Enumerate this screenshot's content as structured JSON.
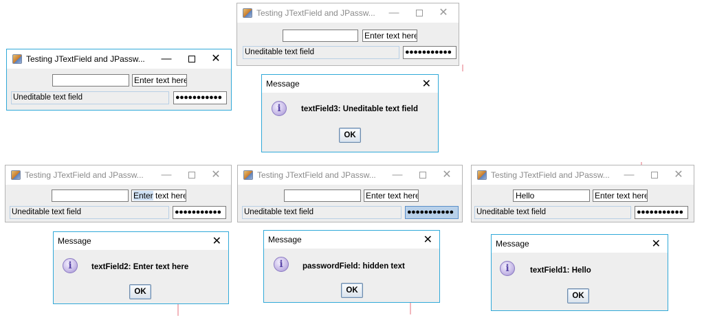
{
  "window_title": "Testing JTextField and JPassw...",
  "fields": {
    "unedit_label": "Uneditable text field",
    "enter_text": "Enter text here",
    "password_mask": "●●●●●●●●●●●"
  },
  "windows": [
    {
      "id": "top-center",
      "textField1": "",
      "state": "inactive"
    },
    {
      "id": "top-left",
      "textField1": "",
      "state": "active"
    },
    {
      "id": "bottom-left",
      "textField1": "",
      "state": "inactive"
    },
    {
      "id": "bottom-center",
      "textField1": "",
      "state": "inactive"
    },
    {
      "id": "bottom-right",
      "textField1": "Hello",
      "state": "inactive"
    }
  ],
  "dialogs": [
    {
      "title": "Message",
      "message": "textField3: Uneditable text field",
      "ok": "OK"
    },
    {
      "title": "Message",
      "message": "textField2: Enter text here",
      "ok": "OK"
    },
    {
      "title": "Message",
      "message": "passwordField: hidden text",
      "ok": "OK"
    },
    {
      "title": "Message",
      "message": "textField1: Hello",
      "ok": "OK"
    }
  ],
  "controls": {
    "minimize": "—",
    "close": "✕"
  },
  "colors": {
    "active_border": "#2fa8d8",
    "panel": "#eeeeee",
    "selection": "#cfe1f5"
  }
}
